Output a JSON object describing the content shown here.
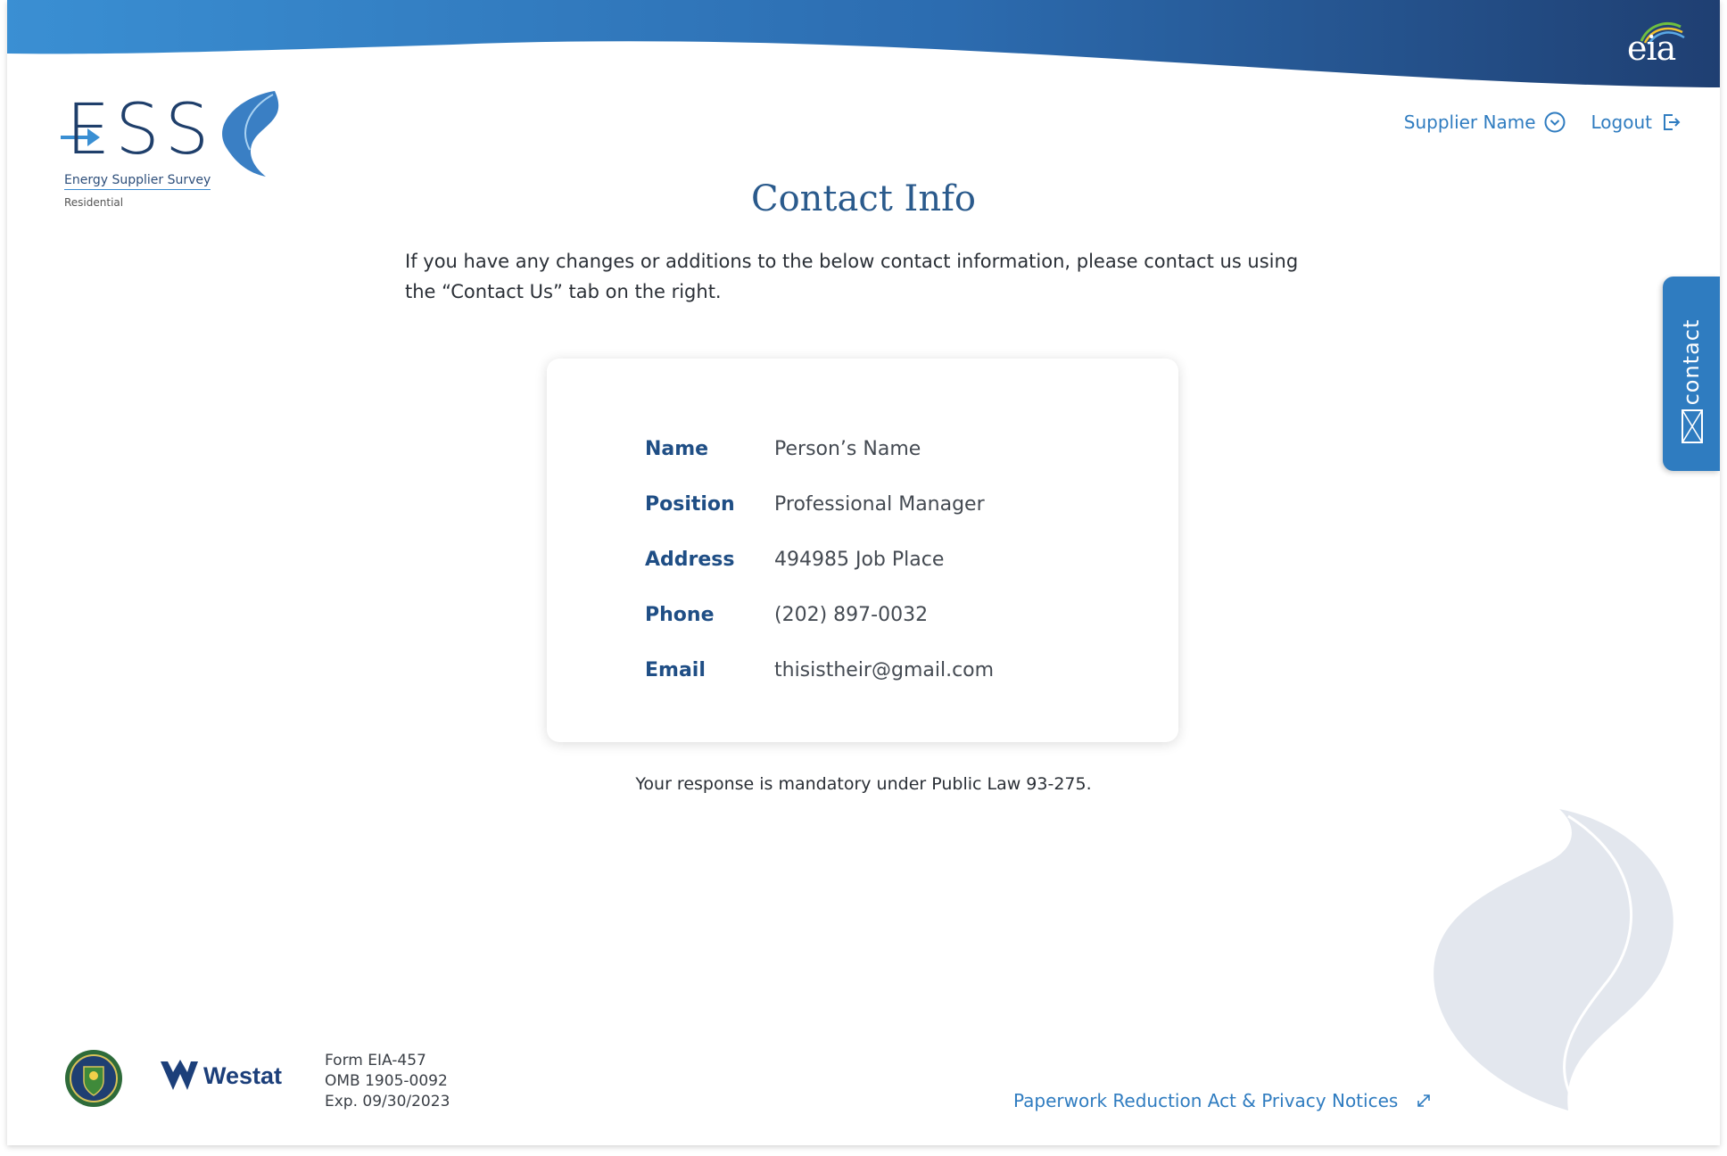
{
  "brand": {
    "eia_label": "eia",
    "ess_letters": "ESS",
    "tagline": "Energy Supplier Survey",
    "subtitle": "Residential",
    "colors": {
      "primary": "#2f7cc0",
      "navy": "#1f3f6b",
      "title": "#2a5a8c"
    }
  },
  "nav": {
    "supplier_label": "Supplier Name",
    "supplier_icon": "chevron-down-circle-icon",
    "logout_label": "Logout",
    "logout_icon": "logout-icon"
  },
  "page": {
    "title": "Contact Info",
    "intro": "If you have any changes or additions to the below contact information, please contact us using the “Contact Us” tab on the right."
  },
  "contact": {
    "rows": [
      {
        "label": "Name",
        "value": "Person’s Name"
      },
      {
        "label": "Position",
        "value": "Professional Manager"
      },
      {
        "label": "Address",
        "value": "494985 Job Place"
      },
      {
        "label": "Phone",
        "value": "(202) 897-0032"
      },
      {
        "label": "Email",
        "value": "thisistheir@gmail.com"
      }
    ]
  },
  "notice": "Your response is mandatory under Public Law 93-275.",
  "side_tab": {
    "label": "contact",
    "icon": "mail-icon"
  },
  "footer": {
    "westat_label": "Westat",
    "form": "Form EIA-457",
    "omb": "OMB 1905-0092",
    "exp": "Exp. 09/30/2023",
    "paperwork_link": "Paperwork Reduction Act & Privacy Notices",
    "link_icon": "external-link-icon"
  }
}
